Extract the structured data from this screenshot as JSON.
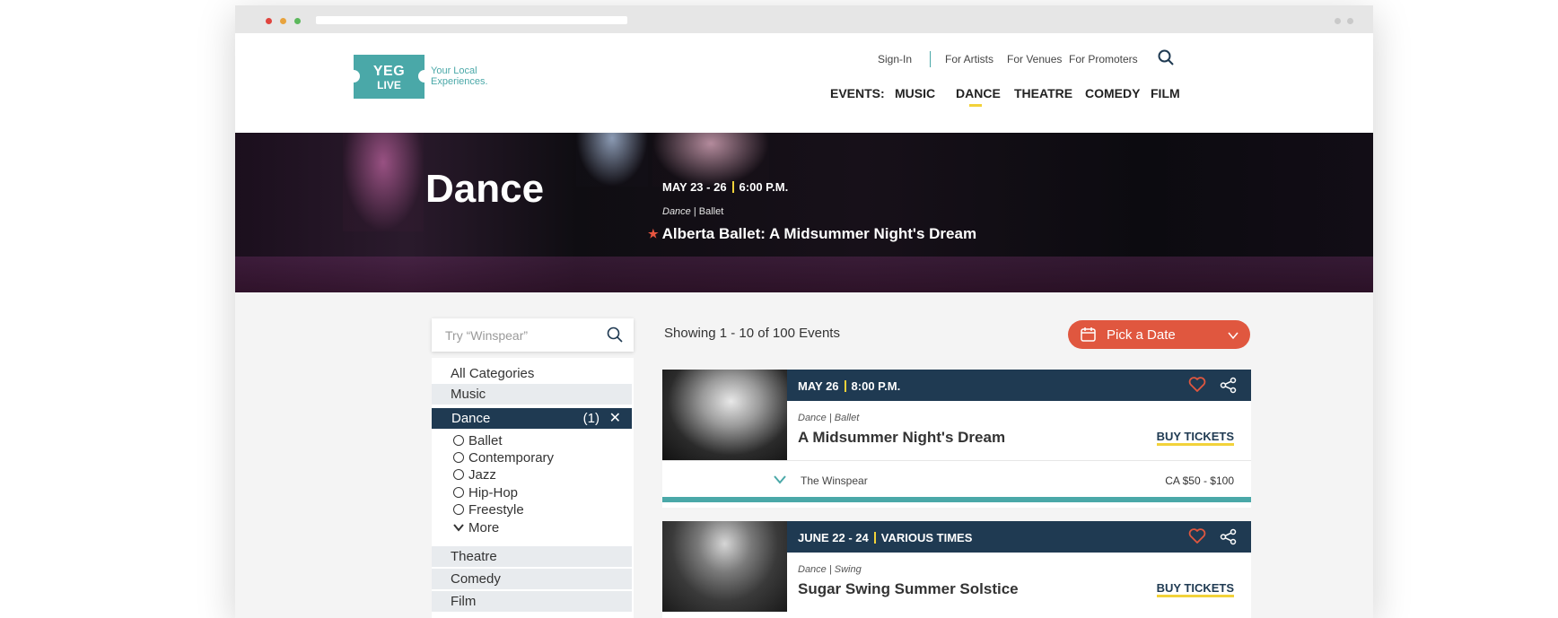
{
  "header": {
    "logo": {
      "line1": "YEG",
      "line2": "LIVE",
      "tagline1": "Your Local",
      "tagline2": "Experiences."
    },
    "top_links": {
      "sign_in": "Sign-In",
      "artists": "For Artists",
      "venues": "For Venues",
      "promoters": "For Promoters"
    },
    "nav": {
      "label": "EVENTS:",
      "items": [
        "MUSIC",
        "DANCE",
        "THEATRE",
        "COMEDY",
        "FILM"
      ],
      "active": "DANCE"
    }
  },
  "hero": {
    "title": "Dance",
    "date": "MAY 23 - 26",
    "time": "6:00 P.M.",
    "category": "Dance",
    "subcategory": "| Ballet",
    "event": "Alberta Ballet: A Midsummer Night's Dream"
  },
  "search": {
    "placeholder": "Try “Winspear”"
  },
  "categories": {
    "all": "All Categories",
    "music": "Music",
    "dance": "Dance",
    "dance_count": "(1)",
    "dance_clear": "✕",
    "subcategories": [
      "Ballet",
      "Contemporary",
      "Jazz",
      "Hip-Hop",
      "Freestyle"
    ],
    "more": "More",
    "theatre": "Theatre",
    "comedy": "Comedy",
    "film": "Film"
  },
  "results": {
    "summary": "Showing 1 - 10 of 100 Events"
  },
  "date_picker": {
    "label": "Pick a Date"
  },
  "events": [
    {
      "date": "MAY 26",
      "time": "8:00 P.M.",
      "category": "Dance | Ballet",
      "title": "A Midsummer Night's Dream",
      "buy": "BUY TICKETS",
      "venue": "The Winspear",
      "price": "CA $50 - $100"
    },
    {
      "date": "JUNE 22 - 24",
      "time": "VARIOUS TIMES",
      "category": "Dance | Swing",
      "title": "Sugar Swing Summer Solstice",
      "buy": "BUY TICKETS"
    }
  ],
  "colors": {
    "teal": "#4aa8a8",
    "navy": "#1f3a52",
    "accent": "#e0573f",
    "yellow": "#f2d23a"
  }
}
